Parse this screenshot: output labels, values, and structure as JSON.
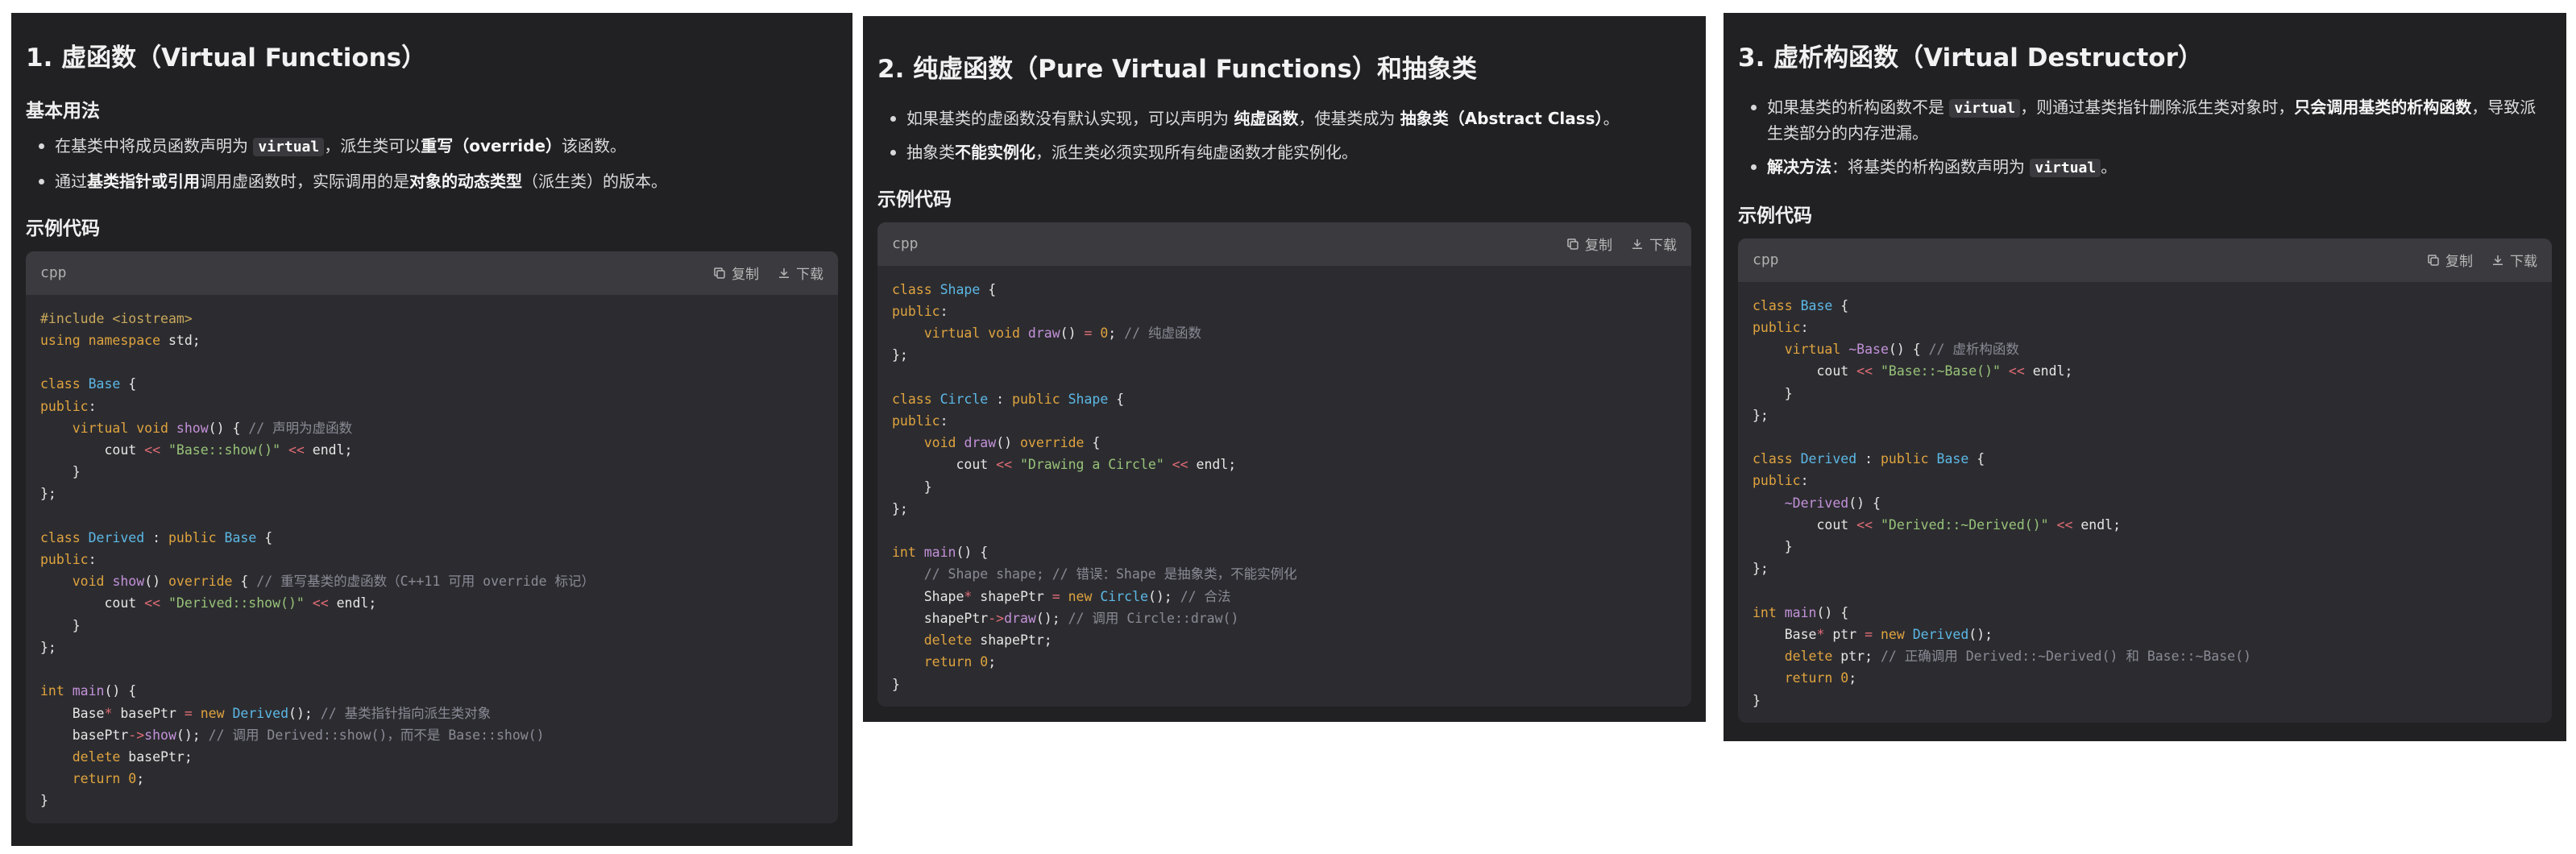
{
  "panels": [
    {
      "title": "1. 虚函数（Virtual Functions）",
      "subtitle": "基本用法",
      "bullets": [
        [
          {
            "t": "在基类中将成员函数声明为 ",
            "s": ""
          },
          {
            "t": "virtual",
            "s": "kw"
          },
          {
            "t": "，派生类可以",
            "s": ""
          },
          {
            "t": "重写（override）",
            "s": "b"
          },
          {
            "t": "该函数。",
            "s": ""
          }
        ],
        [
          {
            "t": "通过",
            "s": ""
          },
          {
            "t": "基类指针或引用",
            "s": "b"
          },
          {
            "t": "调用虚函数时，实际调用的是",
            "s": ""
          },
          {
            "t": "对象的动态类型",
            "s": "b"
          },
          {
            "t": "（派生类）的版本。",
            "s": ""
          }
        ]
      ],
      "example_label": "示例代码",
      "code": {
        "lang": "cpp",
        "copy_label": "复制",
        "download_label": "下载",
        "lines": [
          [
            [
              "pp",
              "#include <iostream>"
            ]
          ],
          [
            [
              "k",
              "using"
            ],
            [
              "",
              ""
            ],
            [
              "k",
              " namespace"
            ],
            [
              "",
              " std;"
            ]
          ],
          [],
          [
            [
              "k",
              "class"
            ],
            [
              "",
              " "
            ],
            [
              "ty",
              "Base"
            ],
            [
              "",
              " {"
            ]
          ],
          [
            [
              "k",
              "public"
            ],
            [
              "",
              ":"
            ]
          ],
          [
            [
              "",
              " "
            ],
            [
              "k",
              "virtual"
            ],
            [
              "",
              " "
            ],
            [
              "k",
              "void"
            ],
            [
              "",
              " "
            ],
            [
              "kv",
              "show"
            ],
            [
              "",
              "() { "
            ],
            [
              "cm",
              "// 声明为虚函数"
            ]
          ],
          [
            [
              "",
              " cout "
            ],
            [
              "op",
              "<<"
            ],
            [
              "",
              " "
            ],
            [
              "st",
              "\"Base::show()\""
            ],
            [
              "",
              " "
            ],
            [
              "op",
              "<<"
            ],
            [
              "",
              " endl;"
            ]
          ],
          [
            [
              "",
              " }"
            ]
          ],
          [
            [
              "",
              "};"
            ]
          ],
          [],
          [
            [
              "k",
              "class"
            ],
            [
              "",
              " "
            ],
            [
              "ty",
              "Derived"
            ],
            [
              "",
              " : "
            ],
            [
              "k",
              "public"
            ],
            [
              "",
              " "
            ],
            [
              "ty",
              "Base"
            ],
            [
              "",
              " {"
            ]
          ],
          [
            [
              "k",
              "public"
            ],
            [
              "",
              ":"
            ]
          ],
          [
            [
              "",
              " "
            ],
            [
              "k",
              "void"
            ],
            [
              "",
              " "
            ],
            [
              "kv",
              "show"
            ],
            [
              "",
              "() "
            ],
            [
              "k",
              "override"
            ],
            [
              "",
              " { "
            ],
            [
              "cm",
              "// 重写基类的虚函数（C++11 可用 override 标记）"
            ]
          ],
          [
            [
              "",
              " cout "
            ],
            [
              "op",
              "<<"
            ],
            [
              "",
              " "
            ],
            [
              "st",
              "\"Derived::show()\""
            ],
            [
              "",
              " "
            ],
            [
              "op",
              "<<"
            ],
            [
              "",
              " endl;"
            ]
          ],
          [
            [
              "",
              " }"
            ]
          ],
          [
            [
              "",
              "};"
            ]
          ],
          [],
          [
            [
              "k",
              "int"
            ],
            [
              "",
              " "
            ],
            [
              "kv",
              "main"
            ],
            [
              "",
              "() {"
            ]
          ],
          [
            [
              "",
              " Base"
            ],
            [
              "op",
              "*"
            ],
            [
              "",
              " basePtr "
            ],
            [
              "op",
              "="
            ],
            [
              "",
              " "
            ],
            [
              "k",
              "new"
            ],
            [
              "",
              " "
            ],
            [
              "ty",
              "Derived"
            ],
            [
              "",
              "(); "
            ],
            [
              "cm",
              "// 基类指针指向派生类对象"
            ]
          ],
          [
            [
              "",
              " basePtr"
            ],
            [
              "op",
              "->"
            ],
            [
              "kv",
              "show"
            ],
            [
              "",
              "(); "
            ],
            [
              "cm",
              "// 调用 Derived::show()，而不是 Base::show()"
            ]
          ],
          [
            [
              "",
              " "
            ],
            [
              "k",
              "delete"
            ],
            [
              "",
              " basePtr;"
            ]
          ],
          [
            [
              "",
              " "
            ],
            [
              "k",
              "return"
            ],
            [
              "",
              " "
            ],
            [
              "nu",
              "0"
            ],
            [
              "",
              ";"
            ]
          ],
          [
            [
              "",
              "}"
            ]
          ]
        ]
      }
    },
    {
      "title": "2. 纯虚函数（Pure Virtual Functions）和抽象类",
      "subtitle": "",
      "bullets": [
        [
          {
            "t": "如果基类的虚函数没有默认实现，可以声明为 ",
            "s": ""
          },
          {
            "t": "纯虚函数",
            "s": "b"
          },
          {
            "t": "，使基类成为 ",
            "s": ""
          },
          {
            "t": "抽象类（Abstract Class）",
            "s": "b"
          },
          {
            "t": "。",
            "s": ""
          }
        ],
        [
          {
            "t": "抽象类",
            "s": ""
          },
          {
            "t": "不能实例化",
            "s": "b"
          },
          {
            "t": "，派生类必须实现所有纯虚函数才能实例化。",
            "s": ""
          }
        ]
      ],
      "example_label": "示例代码",
      "code": {
        "lang": "cpp",
        "copy_label": "复制",
        "download_label": "下载",
        "lines": [
          [
            [
              "k",
              "class"
            ],
            [
              "",
              " "
            ],
            [
              "ty",
              "Shape"
            ],
            [
              "",
              " {"
            ]
          ],
          [
            [
              "k",
              "public"
            ],
            [
              "",
              ":"
            ]
          ],
          [
            [
              "",
              " "
            ],
            [
              "k",
              "virtual"
            ],
            [
              "",
              " "
            ],
            [
              "k",
              "void"
            ],
            [
              "",
              " "
            ],
            [
              "kv",
              "draw"
            ],
            [
              "",
              "() "
            ],
            [
              "op",
              "="
            ],
            [
              "",
              " "
            ],
            [
              "nu",
              "0"
            ],
            [
              "",
              "; "
            ],
            [
              "cm",
              "// 纯虚函数"
            ]
          ],
          [
            [
              "",
              "};"
            ]
          ],
          [],
          [
            [
              "k",
              "class"
            ],
            [
              "",
              " "
            ],
            [
              "ty",
              "Circle"
            ],
            [
              "",
              " : "
            ],
            [
              "k",
              "public"
            ],
            [
              "",
              " "
            ],
            [
              "ty",
              "Shape"
            ],
            [
              "",
              " {"
            ]
          ],
          [
            [
              "k",
              "public"
            ],
            [
              "",
              ":"
            ]
          ],
          [
            [
              "",
              " "
            ],
            [
              "k",
              "void"
            ],
            [
              "",
              " "
            ],
            [
              "kv",
              "draw"
            ],
            [
              "",
              "() "
            ],
            [
              "k",
              "override"
            ],
            [
              "",
              " {"
            ]
          ],
          [
            [
              "",
              " cout "
            ],
            [
              "op",
              "<<"
            ],
            [
              "",
              " "
            ],
            [
              "st",
              "\"Drawing a Circle\""
            ],
            [
              "",
              " "
            ],
            [
              "op",
              "<<"
            ],
            [
              "",
              " endl;"
            ]
          ],
          [
            [
              "",
              " }"
            ]
          ],
          [
            [
              "",
              "};"
            ]
          ],
          [],
          [
            [
              "k",
              "int"
            ],
            [
              "",
              " "
            ],
            [
              "kv",
              "main"
            ],
            [
              "",
              "() {"
            ]
          ],
          [
            [
              "",
              " "
            ],
            [
              "cm",
              "// Shape shape; // 错误：Shape 是抽象类，不能实例化"
            ]
          ],
          [
            [
              "",
              " Shape"
            ],
            [
              "op",
              "*"
            ],
            [
              "",
              " shapePtr "
            ],
            [
              "op",
              "="
            ],
            [
              "",
              " "
            ],
            [
              "k",
              "new"
            ],
            [
              "",
              " "
            ],
            [
              "ty",
              "Circle"
            ],
            [
              "",
              "(); "
            ],
            [
              "cm",
              "// 合法"
            ]
          ],
          [
            [
              "",
              " shapePtr"
            ],
            [
              "op",
              "->"
            ],
            [
              "kv",
              "draw"
            ],
            [
              "",
              "(); "
            ],
            [
              "cm",
              "// 调用 Circle::draw()"
            ]
          ],
          [
            [
              "",
              " "
            ],
            [
              "k",
              "delete"
            ],
            [
              "",
              " shapePtr;"
            ]
          ],
          [
            [
              "",
              " "
            ],
            [
              "k",
              "return"
            ],
            [
              "",
              " "
            ],
            [
              "nu",
              "0"
            ],
            [
              "",
              ";"
            ]
          ],
          [
            [
              "",
              "}"
            ]
          ]
        ]
      }
    },
    {
      "title": "3. 虚析构函数（Virtual Destructor）",
      "subtitle": "",
      "bullets": [
        [
          {
            "t": "如果基类的析构函数不是 ",
            "s": ""
          },
          {
            "t": "virtual",
            "s": "kw"
          },
          {
            "t": "，则通过基类指针删除派生类对象时，",
            "s": ""
          },
          {
            "t": "只会调用基类的析构函数",
            "s": "b"
          },
          {
            "t": "，导致派生类部分的内存泄漏。",
            "s": ""
          }
        ],
        [
          {
            "t": "解决方法",
            "s": "b"
          },
          {
            "t": "：将基类的析构函数声明为 ",
            "s": ""
          },
          {
            "t": "virtual",
            "s": "kw"
          },
          {
            "t": "。",
            "s": ""
          }
        ]
      ],
      "example_label": "示例代码",
      "code": {
        "lang": "cpp",
        "copy_label": "复制",
        "download_label": "下载",
        "lines": [
          [
            [
              "k",
              "class"
            ],
            [
              "",
              " "
            ],
            [
              "ty",
              "Base"
            ],
            [
              "",
              " {"
            ]
          ],
          [
            [
              "k",
              "public"
            ],
            [
              "",
              ":"
            ]
          ],
          [
            [
              "",
              " "
            ],
            [
              "k",
              "virtual"
            ],
            [
              "",
              " "
            ],
            [
              "kv",
              "~Base"
            ],
            [
              "",
              "() { "
            ],
            [
              "cm",
              "// 虚析构函数"
            ]
          ],
          [
            [
              "",
              " cout "
            ],
            [
              "op",
              "<<"
            ],
            [
              "",
              " "
            ],
            [
              "st",
              "\"Base::~Base()\""
            ],
            [
              "",
              " "
            ],
            [
              "op",
              "<<"
            ],
            [
              "",
              " endl;"
            ]
          ],
          [
            [
              "",
              " }"
            ]
          ],
          [
            [
              "",
              "};"
            ]
          ],
          [],
          [
            [
              "k",
              "class"
            ],
            [
              "",
              " "
            ],
            [
              "ty",
              "Derived"
            ],
            [
              "",
              " : "
            ],
            [
              "k",
              "public"
            ],
            [
              "",
              " "
            ],
            [
              "ty",
              "Base"
            ],
            [
              "",
              " {"
            ]
          ],
          [
            [
              "k",
              "public"
            ],
            [
              "",
              ":"
            ]
          ],
          [
            [
              "",
              " "
            ],
            [
              "kv",
              "~Derived"
            ],
            [
              "",
              "() {"
            ]
          ],
          [
            [
              "",
              " cout "
            ],
            [
              "op",
              "<<"
            ],
            [
              "",
              " "
            ],
            [
              "st",
              "\"Derived::~Derived()\""
            ],
            [
              "",
              " "
            ],
            [
              "op",
              "<<"
            ],
            [
              "",
              " endl;"
            ]
          ],
          [
            [
              "",
              " }"
            ]
          ],
          [
            [
              "",
              "};"
            ]
          ],
          [],
          [
            [
              "k",
              "int"
            ],
            [
              "",
              " "
            ],
            [
              "kv",
              "main"
            ],
            [
              "",
              "() {"
            ]
          ],
          [
            [
              "",
              " Base"
            ],
            [
              "op",
              "*"
            ],
            [
              "",
              " ptr "
            ],
            [
              "op",
              "="
            ],
            [
              "",
              " "
            ],
            [
              "k",
              "new"
            ],
            [
              "",
              " "
            ],
            [
              "ty",
              "Derived"
            ],
            [
              "",
              "();"
            ]
          ],
          [
            [
              "",
              " "
            ],
            [
              "k",
              "delete"
            ],
            [
              "",
              " ptr; "
            ],
            [
              "cm",
              "// 正确调用 Derived::~Derived() 和 Base::~Base()"
            ]
          ],
          [
            [
              "",
              " "
            ],
            [
              "k",
              "return"
            ],
            [
              "",
              " "
            ],
            [
              "nu",
              "0"
            ],
            [
              "",
              ";"
            ]
          ],
          [
            [
              "",
              "}"
            ]
          ]
        ]
      }
    }
  ]
}
